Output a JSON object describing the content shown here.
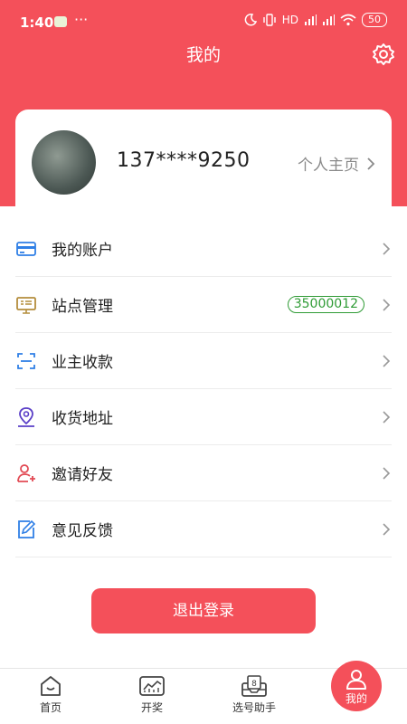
{
  "status_bar": {
    "time": "1:40",
    "dots": "···",
    "network_label": "HD",
    "battery": "50"
  },
  "header": {
    "title": "我的",
    "settings_icon": "gear-icon"
  },
  "profile": {
    "phone": "137****9250",
    "home_link": "个人主页"
  },
  "menu": {
    "items": [
      {
        "label": "我的账户",
        "icon": "wallet-card-icon"
      },
      {
        "label": "站点管理",
        "icon": "monitor-icon",
        "badge": "35000012"
      },
      {
        "label": "业主收款",
        "icon": "scan-icon"
      },
      {
        "label": "收货地址",
        "icon": "map-pin-icon"
      },
      {
        "label": "邀请好友",
        "icon": "user-add-icon"
      },
      {
        "label": "意见反馈",
        "icon": "edit-note-icon"
      }
    ]
  },
  "logout_label": "退出登录",
  "tabbar": {
    "items": [
      {
        "label": "首页"
      },
      {
        "label": "开奖"
      },
      {
        "label": "选号助手"
      },
      {
        "label": "我的",
        "active": true
      }
    ]
  },
  "colors": {
    "accent": "#f4505a",
    "badge_green": "#2f9b35",
    "icon_blue": "#2f7fe6",
    "icon_gold": "#b48d3c",
    "icon_purple": "#5a3fc7",
    "icon_red": "#e24b55"
  }
}
